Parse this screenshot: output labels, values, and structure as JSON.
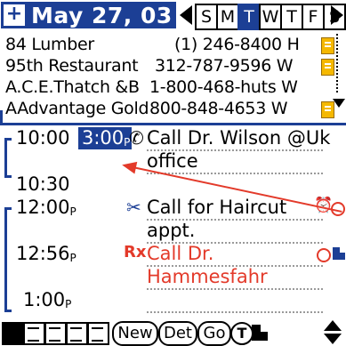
{
  "header": {
    "date_label": "May 27, 03",
    "days": [
      "S",
      "M",
      "T",
      "W",
      "T",
      "F",
      "S"
    ],
    "active_day_index": 2
  },
  "contacts": [
    {
      "name": "84 Lumber",
      "phone": "(1) 246-8400 H",
      "has_note": true
    },
    {
      "name": "95th Restaurant",
      "phone": "312-787-9596 W",
      "has_note": true
    },
    {
      "name": "A.C.E.Thatch &B",
      "phone": "1-800-468-huts W",
      "has_note": false
    },
    {
      "name": "AAdvantage Gold",
      "phone": "800-848-4653 W",
      "has_note": true
    }
  ],
  "agenda": {
    "times": [
      "10:00",
      "10:30",
      "12:00",
      "12:56",
      "1:00"
    ],
    "time_suffix": "P",
    "end_time": "3:00",
    "events": [
      {
        "text_line1": "Call Dr. Wilson @Uk",
        "text_line2": "office",
        "icon": "phone-icon",
        "color": "#000000"
      },
      {
        "text_line1": "Call for Haircut",
        "text_line2": "appt.",
        "icon": "scissors-icon",
        "color": "#000000"
      },
      {
        "text_line1": "Call Dr.",
        "text_line2": "Hammesfahr",
        "icon": "rx-icon",
        "color": "#e33a2a"
      }
    ]
  },
  "toolbar": {
    "new_label": "New",
    "details_label": "Det",
    "go_label": "Go",
    "todo_label": "T"
  },
  "icons": {
    "rx": "Rx"
  },
  "colors": {
    "accent": "#1c3f95",
    "alert": "#e33a2a",
    "note": "#f5b800"
  }
}
